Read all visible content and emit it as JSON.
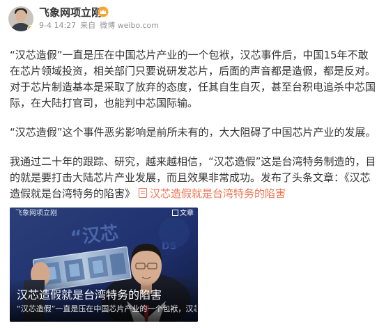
{
  "author": {
    "name": "飞象网项立刚",
    "avatar_icon": "profile-photo",
    "verified_badge_icon": "verified-badge-icon",
    "member_icon": "vip-crown-icon"
  },
  "meta": {
    "time": "9-4 14:27",
    "source_prefix": "来自",
    "source": "微博 weibo.com"
  },
  "post": {
    "paragraphs": [
      "“汉芯造假”一直是压在中国芯片产业的一个包袱，汉芯事件后，中国15年不敢在芯片领域投资，相关部门只要说研发芯片，后面的声音都是造假，都是反对。对于芯片制造基本是采取了放弃的态度，任其自生自灭，甚至台积电追杀中芯国际，在大陆打官司，也能判中芯国际输。",
      "“汉芯造假”这个事件恶劣影响是前所未有的，大大阻碍了中国芯片产业的发展。"
    ],
    "last_paragraph": "我通过二十年的跟踪、研究，越来越相信，“汉芯造假”这是台湾特务制造的，目的就是要打击大陆芯片产业发展，而且效果非常成功。发布了头条文章：《汉芯造假就是台湾特务的陷害》",
    "article_link": "汉芯造假就是台湾特务的陷害"
  },
  "card": {
    "watermark": "飞象网项立刚",
    "tag": "文章",
    "title": "汉芯造假就是台湾特务的陷害",
    "summary": "“汉芯造假”一直是压在中国芯片产业的一个包袱，汉芯..."
  },
  "colors": {
    "link": "#eb7350",
    "meta": "#939393",
    "text": "#333333"
  }
}
